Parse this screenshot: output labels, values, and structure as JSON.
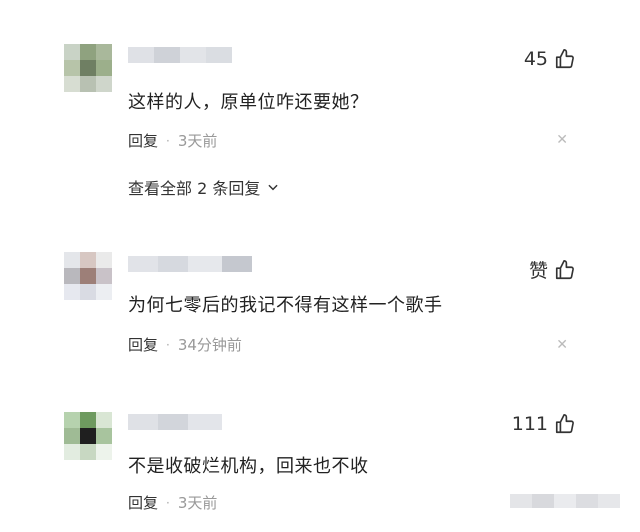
{
  "comments": [
    {
      "like_count": "45",
      "text": "这样的人，原单位咋还要她？",
      "reply_label": "回复",
      "time": "3天前",
      "expand_label": "查看全部 2 条回复",
      "avatar_colors": [
        "#c9d3c6",
        "#8fa27f",
        "#a9b89b",
        "#b7c4a9",
        "#6f7f63",
        "#9caf8b",
        "#d7ddd2",
        "#b8c1b2",
        "#cfd6cb"
      ]
    },
    {
      "like_count": "赞",
      "text": "为何七零后的我记不得有这样一个歌手",
      "reply_label": "回复",
      "time": "34分钟前",
      "avatar_colors": [
        "#e4e6ea",
        "#d7c7c2",
        "#eaeaea",
        "#b9b8bd",
        "#9d7f78",
        "#c9c2c8",
        "#e6e8ef",
        "#d9dbe3",
        "#eceef2"
      ]
    },
    {
      "like_count": "111",
      "text": "不是收破烂机构，回来也不收",
      "reply_label": "回复",
      "time": "3天前",
      "avatar_colors": [
        "#b6d2ae",
        "#6e9a5f",
        "#d9e6d4",
        "#9fbb95",
        "#1f1f1f",
        "#a8c49e",
        "#e2ece0",
        "#c8d8c2",
        "#edf3eb"
      ]
    }
  ],
  "colors": {
    "text": "#222222",
    "meta": "#999999"
  },
  "icons": {
    "like": "thumbs-up-icon",
    "close": "close-icon",
    "expand": "chevron-down-icon"
  }
}
